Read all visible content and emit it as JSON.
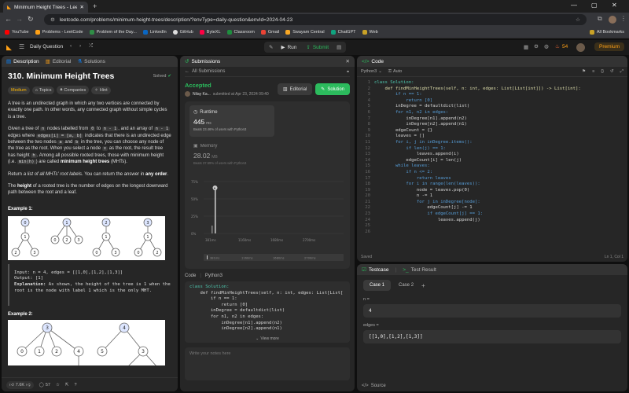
{
  "browser": {
    "tab_title": "Minimum Height Trees - LeetC",
    "url": "leetcode.com/problems/minimum-height-trees/description/?envType=daily-question&envId=2024-04-23",
    "bookmarks": [
      "YouTube",
      "Problems - LeetCode",
      "Problem of the Day...",
      "LinkedIn",
      "GitHub",
      "ByteXL",
      "Classroom",
      "Gmail",
      "Swayam Central",
      "ChatGPT",
      "Web"
    ],
    "all_bookmarks": "All Bookmarks"
  },
  "nav": {
    "daily_question": "Daily Question",
    "run": "Run",
    "submit": "Submit",
    "streak": "54",
    "premium": "Premium"
  },
  "left": {
    "tabs": [
      "Description",
      "Editorial",
      "Solutions"
    ],
    "title": "310. Minimum Height Trees",
    "solved": "Solved",
    "difficulty": "Medium",
    "chips": [
      "Topics",
      "Companies",
      "Hint"
    ],
    "p1": "A tree is an undirected graph in which any two vertices are connected by exactly one path. In other words, any connected graph without simple cycles is a tree.",
    "p2a": "Given a tree of",
    "p2b": "nodes labelled from",
    "p2c": "to",
    "p2d": ", and an array of",
    "p2e": "edges where",
    "p2f": "indicates that there is an undirected edge between the two nodes",
    "p2g": "and",
    "p2h": "in the tree, you can choose any node of the tree as the root. When you select a node",
    "p2i": "as the root, the result tree has height",
    "p2j": ". Among all possible rooted trees, those with minimum height (i.e.",
    "p2k": ") are called",
    "p2l": "minimum height trees",
    "p2m": "(MHTs).",
    "code_n": "n",
    "code_0": "0",
    "code_n1": "n - 1",
    "code_n1b": "n - 1",
    "code_edge": "edges[i] = [a, b]",
    "code_ai": "a",
    "code_bi": "b",
    "code_x": "x",
    "code_h": "h",
    "code_minh": "min(h)",
    "p3a": "Return",
    "p3b": "a list of all MHTs' root labels",
    "p3c": ". You can return the answer in",
    "p3d": "any order",
    "p4a": "The",
    "p4b": "height",
    "p4c": "of a rooted tree is the number of edges on the longest downward path between the root and a leaf.",
    "ex1": "Example 1:",
    "ex1_input": "Input: n = 4, edges = [[1,0],[1,2],[1,3]]",
    "ex1_output": "Output: [1]",
    "ex1_expl_label": "Explanation:",
    "ex1_expl": "As shown, the height of the tree is 1 when the root is the node with label 1 which is the only MHT.",
    "ex2": "Example 2:",
    "likes": "7.6K",
    "comments": "57"
  },
  "submissions": {
    "tab": "Submissions",
    "back": "All Submissions",
    "status": "Accepted",
    "user": "Nilay Ka...",
    "submitted": "submitted at Apr 23, 2024 09:40",
    "editorial": "Editorial",
    "solution": "Solution",
    "runtime_label": "Runtime",
    "runtime_value": "445",
    "runtime_unit": "ms",
    "runtime_beats": "Beats 23.46% of users with Python3",
    "memory_label": "Memory",
    "memory_value": "28.02",
    "memory_unit": "MB",
    "memory_beats": "Beats 37.59% of users with Python3",
    "chart_yticks": [
      "75%",
      "50%",
      "25%",
      "0%"
    ],
    "chart_xticks": [
      "381ms",
      "1160ms",
      "1680ms",
      "2700ms"
    ],
    "mini_xticks": [
      "381ms",
      "1160ms",
      "1680ms",
      "2700ms"
    ],
    "code_label": "Code",
    "code_lang": "Python3",
    "code_lines": [
      "class Solution:",
      "    def findMinHeightTrees(self, n: int, edges: List[List[",
      "        if n == 1:",
      "            return [0]",
      "        inDegree = defaultdict(list)",
      "        for n1, n2 in edges:",
      "            inDegree[n1].append(n2)",
      "            inDegree[n2].append(n1)"
    ],
    "view_more": "View more",
    "notes_placeholder": "Write your notes here"
  },
  "editor": {
    "tab": "Code",
    "lang": "Python3",
    "auto": "Auto",
    "status": "Saved",
    "cursor": "Ln 1, Col 1",
    "lines": [
      "class Solution:",
      "    def findMinHeightTrees(self, n: int, edges: List[List[int]]) -> List[int]:",
      "        if n == 1:",
      "            return [0]",
      "        inDegree = defaultdict(list)",
      "        for n1, n2 in edges:",
      "            inDegree[n1].append(n2)",
      "            inDegree[n2].append(n1)",
      "",
      "        edgeCount = {}",
      "        leaves = []",
      "        for i, j in inDegree.items():",
      "            if len(j) == 1:",
      "                leaves.append(i)",
      "            edgeCount[i] = len(j)",
      "",
      "        while leaves:",
      "            if n <= 2:",
      "                return leaves",
      "            for i in range(len(leaves)):",
      "                node = leaves.pop(0)",
      "                n -= 1",
      "                for j in inDegree[node]:",
      "                    edgeCount[j] -= 1",
      "                    if edgeCount[j] == 1:",
      "                        leaves.append(j)"
    ]
  },
  "testcase": {
    "tab1": "Testcase",
    "tab2": "Test Result",
    "cases": [
      "Case 1",
      "Case 2"
    ],
    "n_label": "n =",
    "n_value": "4",
    "edges_label": "edges =",
    "edges_value": "[[1,0],[1,2],[1,3]]",
    "source": "Source"
  },
  "colors": {
    "accent": "#ffa116",
    "green": "#2cbb5d",
    "blue": "#0a84ff"
  }
}
